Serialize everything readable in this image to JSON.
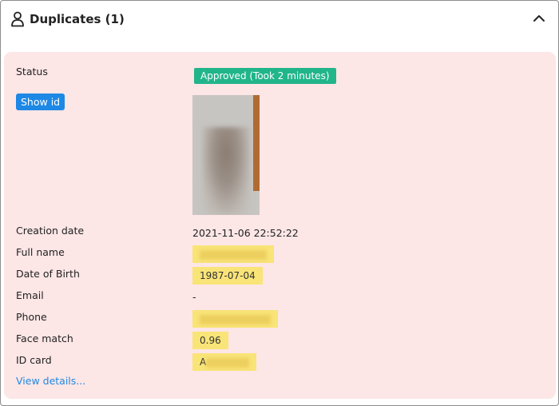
{
  "header": {
    "title": "Duplicates (1)"
  },
  "duplicate": {
    "status_label": "Status",
    "status_badge": "Approved (Took 2 minutes)",
    "show_id_label": "Show id",
    "creation_date_label": "Creation date",
    "creation_date_value": "2021-11-06 22:52:22",
    "full_name_label": "Full name",
    "date_of_birth_label": "Date of Birth",
    "date_of_birth_value": "1987-07-04",
    "email_label": "Email",
    "email_value": "-",
    "phone_label": "Phone",
    "face_match_label": "Face match",
    "face_match_value": "0.96",
    "id_card_label": "ID card",
    "id_card_value_prefix": "A",
    "view_details_label": "View details..."
  },
  "colors": {
    "card_background": "#fde6e6",
    "approved_badge": "#21b58a",
    "primary_button": "#1e88e5",
    "highlight": "#f9e478"
  },
  "icons": {
    "header": "user-icon",
    "collapse": "chevron-up-icon"
  }
}
